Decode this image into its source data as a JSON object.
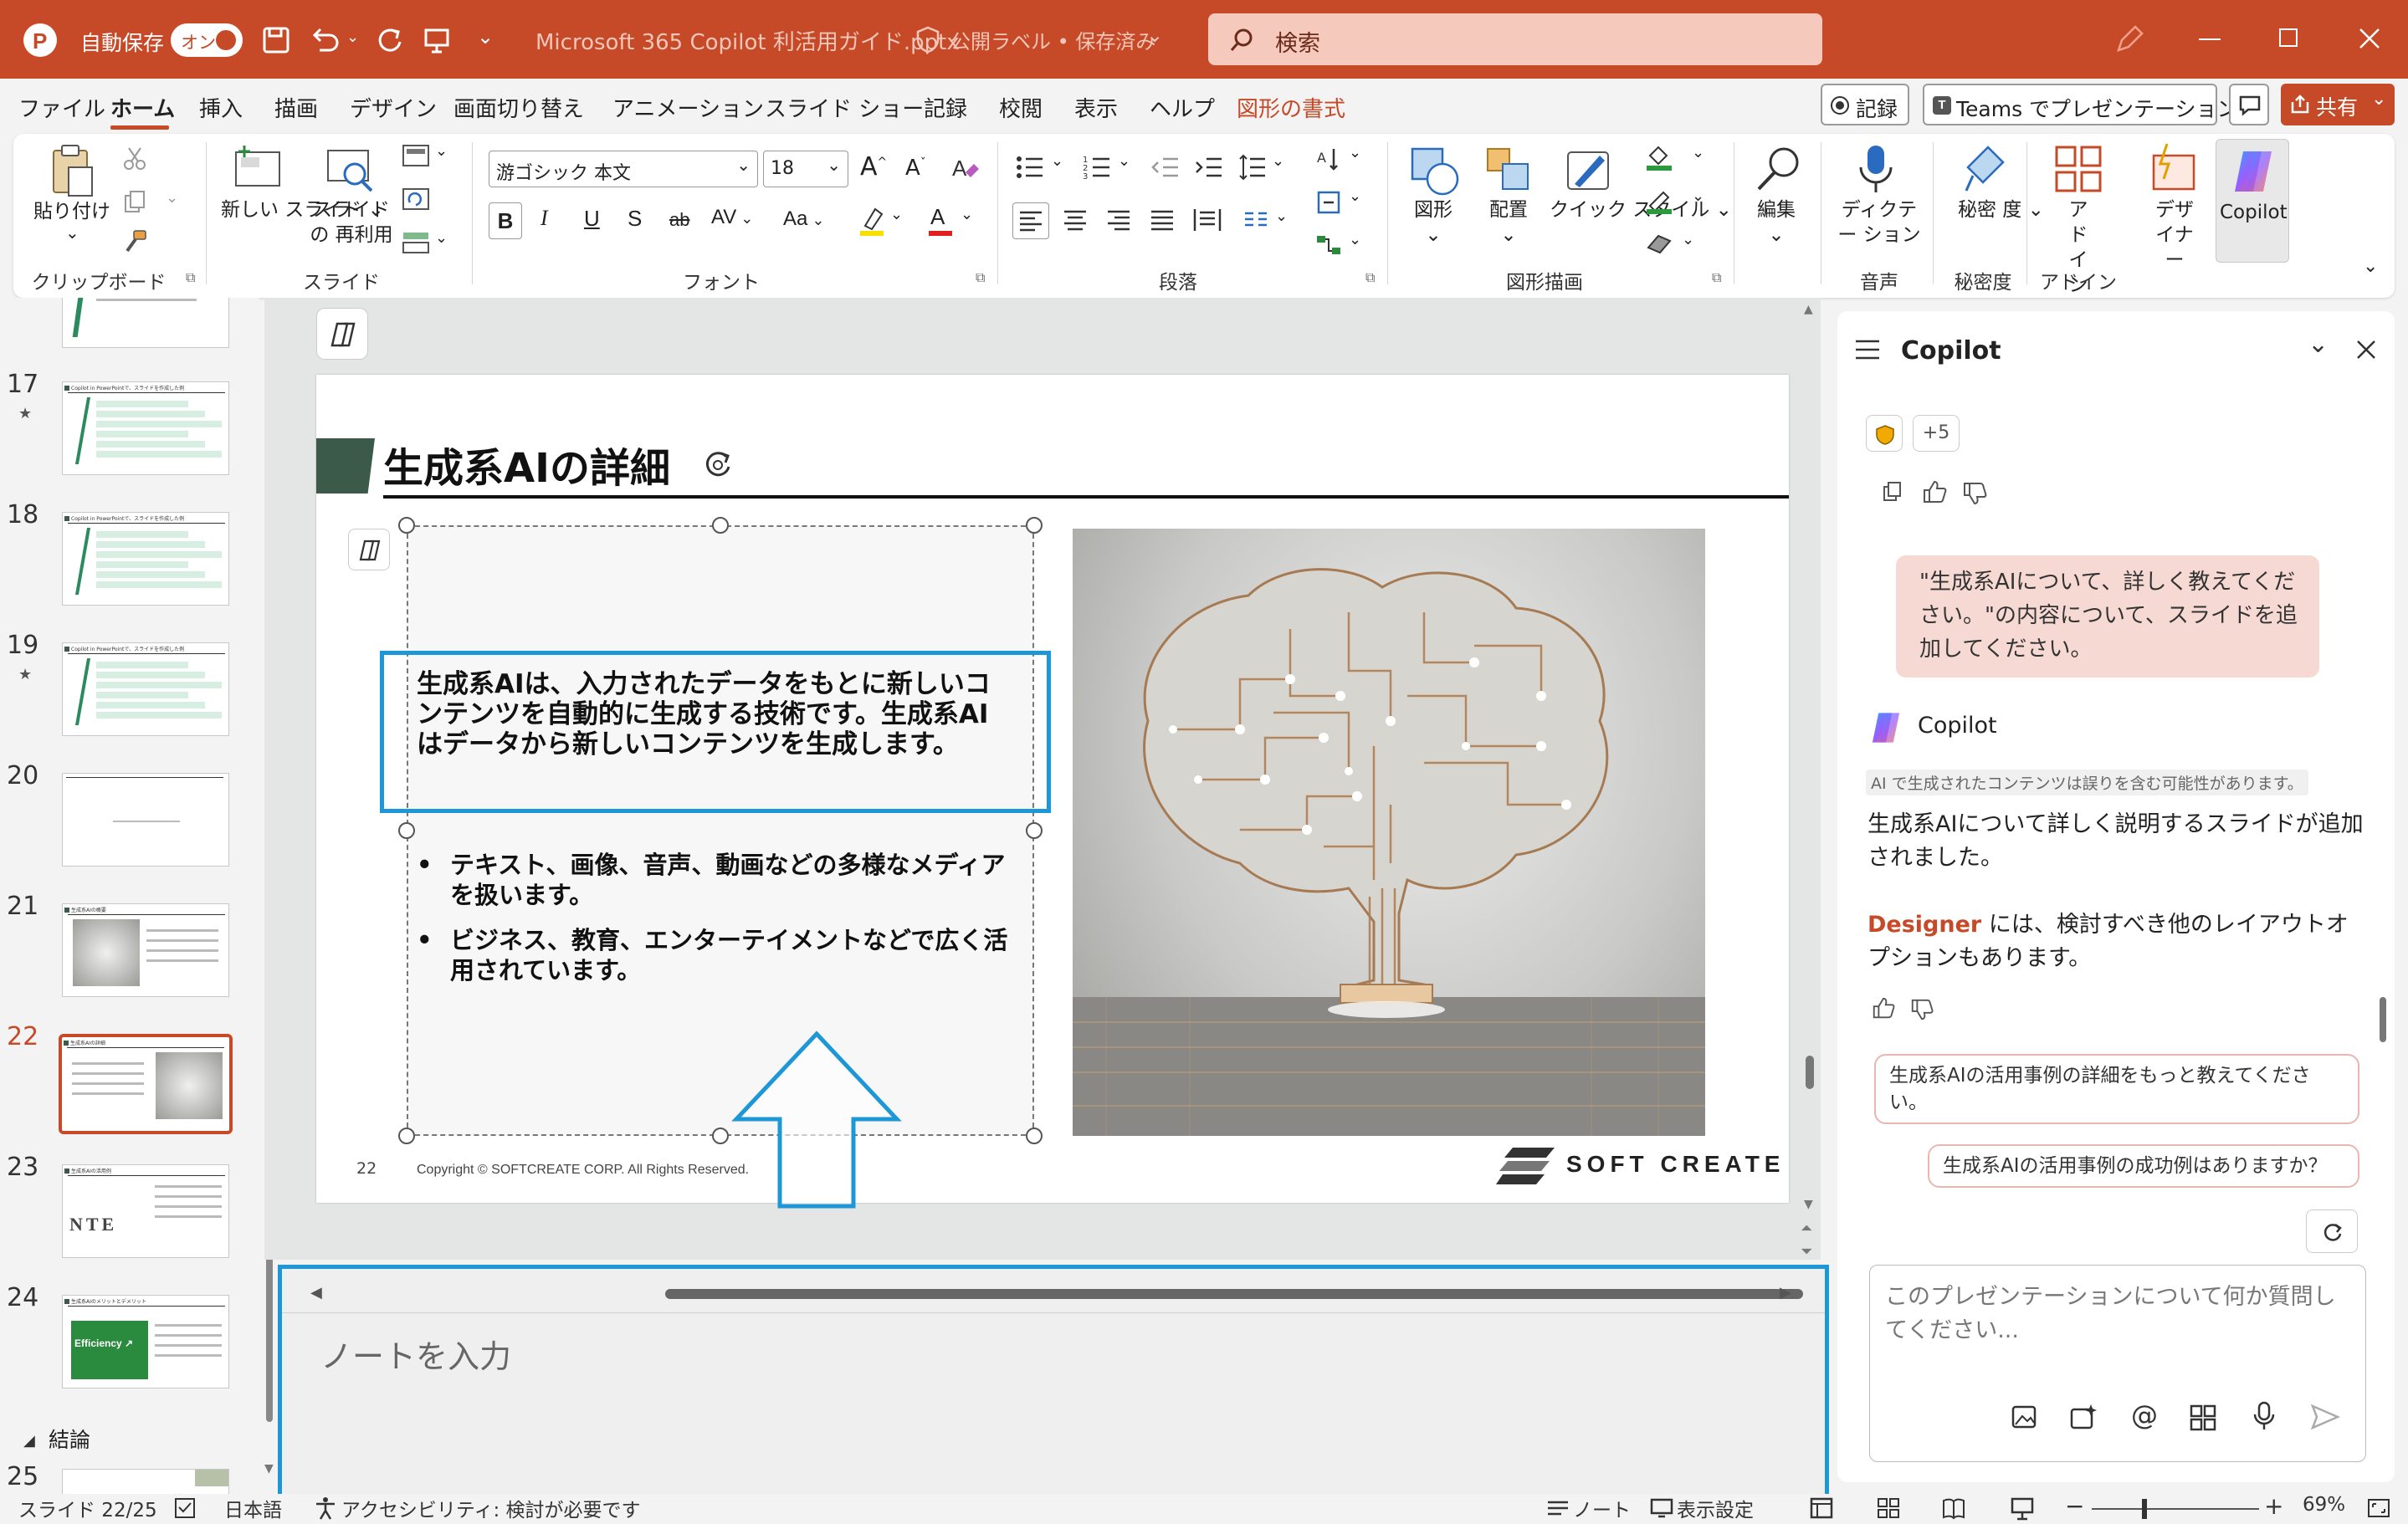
{
  "titlebar": {
    "autosave_label": "自動保存",
    "autosave_toggle": "オン",
    "document_title": "Microsoft 365 Copilot 利活用ガイド.pptx",
    "sensitivity": "公開ラベル • 保存済み",
    "search_placeholder": "検索"
  },
  "menu": {
    "tabs": [
      "ファイル",
      "ホーム",
      "挿入",
      "描画",
      "デザイン",
      "画面切り替え",
      "アニメーション",
      "スライド ショー",
      "記録",
      "校閲",
      "表示",
      "ヘルプ",
      "図形の書式"
    ],
    "active_tab": "ホーム",
    "record_button": "記録",
    "teams_button": "Teams でプレゼンテーション",
    "share_button": "共有"
  },
  "ribbon": {
    "paste": "貼り付け",
    "new_slide": "新しい スライド",
    "reuse_slide": "スライドの 再利用",
    "font_name": "游ゴシック 本文",
    "font_size": "18",
    "shape": "図形",
    "arrange": "配置",
    "quick_style": "クイック スタイル",
    "edit": "編集",
    "dictate": "ディクテー ション",
    "sensitivity": "秘密 度",
    "addins": "アド イン",
    "designer": "デザ イナー",
    "copilot": "Copilot",
    "groups": {
      "clipboard": "クリップボード",
      "slides": "スライド",
      "font": "フォント",
      "paragraph": "段落",
      "drawing": "図形描画",
      "voice": "音声",
      "sensitivity": "秘密度",
      "addins": "アドイン"
    }
  },
  "thumbnails": [
    {
      "num": "17",
      "star": "★",
      "title": "Copilot in PowerPointで、スライドを作成した例"
    },
    {
      "num": "18",
      "star": "",
      "title": "Copilot in PowerPointで、スライドを作成した例"
    },
    {
      "num": "19",
      "star": "★",
      "title": "Copilot in PowerPointで、スライドを作成した例"
    },
    {
      "num": "20",
      "star": "",
      "title": ""
    },
    {
      "num": "21",
      "star": "",
      "title": "生成系AIの概要"
    },
    {
      "num": "22",
      "star": "",
      "title": "生成系AIの詳細"
    },
    {
      "num": "23",
      "star": "",
      "title": "生成系AIの活用例"
    },
    {
      "num": "24",
      "star": "",
      "title": "生成系AIのメリットとデメリット"
    }
  ],
  "section_label": "結論",
  "next_slide_num": "25",
  "slide": {
    "title": "生成系AIの詳細",
    "lead": "生成系AIは、入力されたデータをもとに新しいコンテンツを自動的に生成する技術です。生成系AIはデータから新しいコンテンツを生成します。",
    "bullets": [
      "テキスト、画像、音声、動画などの多様なメディアを扱います。",
      "ビジネス、教育、エンターテイメントなどで広く活用されています。"
    ],
    "page_number": "22",
    "copyright": "Copyright © SOFTCREATE CORP. All Rights Reserved.",
    "logo": "SOFT CREATE"
  },
  "notes_placeholder": "ノートを入力",
  "copilot": {
    "title": "Copilot",
    "badge_count": "+5",
    "user_message": "\"生成系AIについて、詳しく教えてください。\"の内容について、スライドを追加してください。",
    "assistant_name": "Copilot",
    "disclaimer": "AI で生成されたコンテンツは誤りを含む可能性があります。",
    "response": "生成系AIについて詳しく説明するスライドが追加されました。",
    "designer_word": "Designer",
    "designer_text": " には、検討すべき他のレイアウトオプションもあります。",
    "suggestions": [
      "生成系AIの活用事例の詳細をもっと教えてください。",
      "生成系AIの活用事例の成功例はありますか？"
    ],
    "input_placeholder": "このプレゼンテーションについて何か質問してください..."
  },
  "status": {
    "slide_count": "スライド 22/25",
    "language": "日本語",
    "accessibility": "アクセシビリティ: 検討が必要です",
    "notes": "ノート",
    "display_settings": "表示設定",
    "zoom": "69%"
  },
  "colors": {
    "accent": "#c64a27",
    "highlight_blue": "#1d97d8",
    "slide_green": "#3b5a4a"
  }
}
